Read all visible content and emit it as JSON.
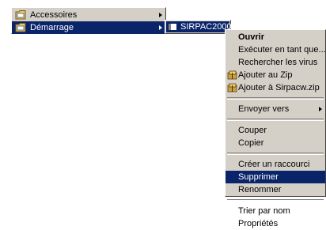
{
  "programs_menu": {
    "items": [
      {
        "label": "Accessoires",
        "icon": "folder-icon"
      },
      {
        "label": "Démarrage",
        "icon": "folder-icon"
      }
    ]
  },
  "startup_submenu": {
    "items": [
      {
        "label": "SIRPAC2000",
        "icon": "program-icon"
      }
    ]
  },
  "context_menu": {
    "items": [
      {
        "label": "Ouvrir"
      },
      {
        "label": "Exécuter en tant que..."
      },
      {
        "label": "Rechercher les virus"
      },
      {
        "label": "Ajouter au Zip",
        "icon": "winzip-icon"
      },
      {
        "label": "Ajouter à Sirpacw.zip",
        "icon": "winzip-icon"
      },
      {
        "label": "Envoyer vers"
      },
      {
        "label": "Couper"
      },
      {
        "label": "Copier"
      },
      {
        "label": "Créer un raccourci"
      },
      {
        "label": "Supprimer"
      },
      {
        "label": "Renommer"
      },
      {
        "label": "Trier par nom"
      },
      {
        "label": "Propriétés"
      }
    ]
  },
  "colors": {
    "highlight": "#0a246a",
    "menu_bg": "#d4d0c8"
  }
}
